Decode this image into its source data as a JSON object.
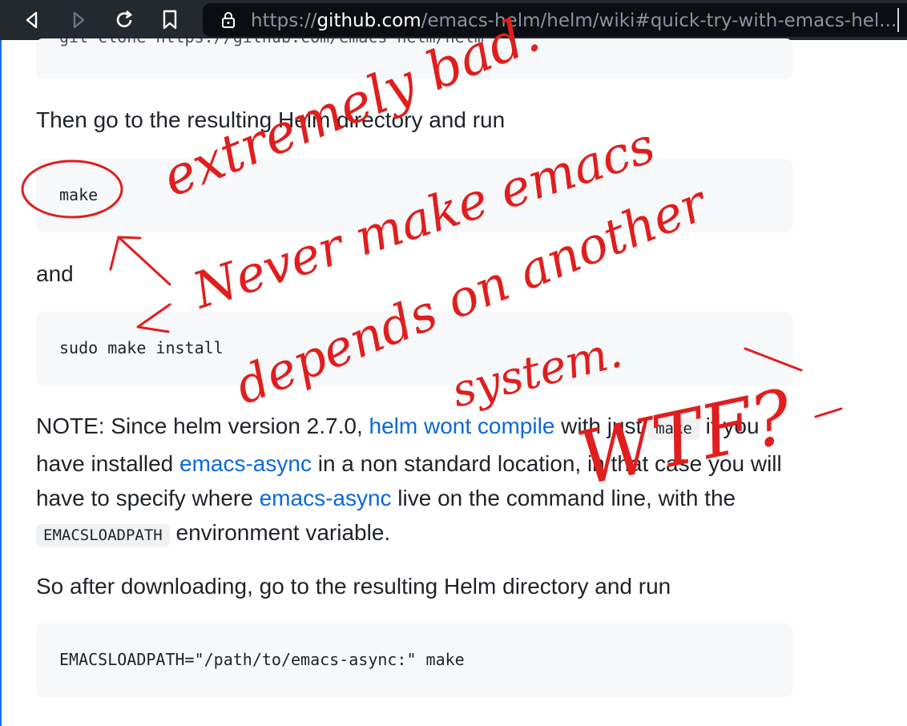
{
  "browser": {
    "url_scheme": "https://",
    "url_host": "github.com",
    "url_path": "/emacs-helm/helm/wiki#quick-try-with-emacs-hel..."
  },
  "page": {
    "top_code_partial": "git clone https://github.com/emacs-helm/helm",
    "para_then": "Then go to the resulting Helm directory and run",
    "code_make": "make",
    "para_and": "and",
    "code_sudo": "sudo make install",
    "note": {
      "prefix": "NOTE: Since helm version 2.7.0, ",
      "link1": "helm wont compile",
      "mid1": " with just ",
      "code_make": "make",
      "mid2": " if you have installed ",
      "link2": "emacs-async",
      "mid3": " in a non standard location, in that case you will have to specify where ",
      "link3": "emacs-async",
      "mid4": " live on the command line, with the ",
      "code_env": "EMACSLOADPATH",
      "suffix": " environment variable."
    },
    "para_so": "So after downloading, go to the resulting Helm directory and run",
    "code_env_make": "EMACSLOADPATH=\"/path/to/emacs-async:\" make"
  },
  "annotation": {
    "line1": "extremely bad.",
    "line2": "Never make emacs",
    "line3": "depends on another",
    "line4": "system.",
    "line5": "WTF?"
  }
}
